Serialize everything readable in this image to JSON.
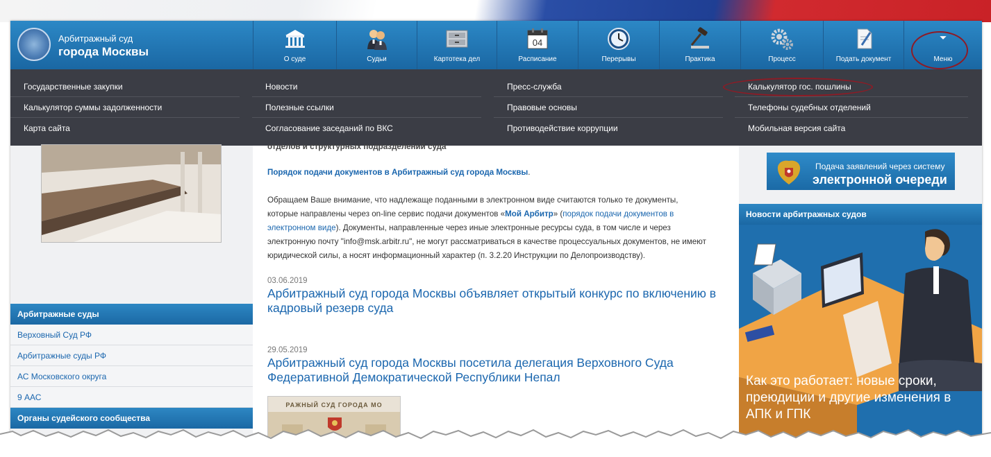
{
  "header": {
    "logo_line1": "Арбитражный суд",
    "logo_line2": "города Москвы"
  },
  "nav": [
    {
      "label": "О суде",
      "icon": "courthouse-icon"
    },
    {
      "label": "Судьи",
      "icon": "judges-icon"
    },
    {
      "label": "Картотека дел",
      "icon": "file-cabinet-icon"
    },
    {
      "label": "Расписание",
      "icon": "calendar-icon",
      "calendar_day": "04"
    },
    {
      "label": "Перерывы",
      "icon": "clock-icon"
    },
    {
      "label": "Практика",
      "icon": "gavel-icon"
    },
    {
      "label": "Процесс",
      "icon": "gears-icon"
    },
    {
      "label": "Подать документ",
      "icon": "document-pen-icon"
    },
    {
      "label": "Меню",
      "icon": "dropdown-arrow-icon"
    }
  ],
  "menu": {
    "col1": [
      "Государственные закупки",
      "Калькулятор суммы задолженности",
      "Карта сайта"
    ],
    "col2": [
      "Новости",
      "Полезные ссылки",
      "Согласование заседаний по ВКС"
    ],
    "col3": [
      "Пресс-служба",
      "Правовые основы",
      "Противодействие коррупции"
    ],
    "col4": [
      "Калькулятор гос. пошлины",
      "Телефоны судебных отделений",
      "Мобильная версия сайта"
    ]
  },
  "left": {
    "courts_header": "Арбитражные суды",
    "courts": [
      "Верховный Суд РФ",
      "Арбитражные суды РФ",
      "АС Московского округа",
      "9 ААС"
    ],
    "bodies_header": "Органы судейского сообщества"
  },
  "center": {
    "cut_text": "отделов и структурных подразделений суда",
    "procedure_link": "Порядок подачи документов в Арбитражный суд города Москвы",
    "notice_l1_a": "Обращаем Ваше внимание, что надлежаще поданными в электронном виде считаются только те документы,",
    "notice_l2_a": "которые направлены через on-line сервис подачи документов «",
    "notice_l2_link": "Мой Арбитр",
    "notice_l2_b": "» (",
    "notice_l2_link2": "порядок подачи документов в",
    "notice_l3_link": "электронном виде",
    "notice_l3_b": "). Документы, направленные через иные электронные ресурсы суда, в том числе и через",
    "notice_l4": "электронную почту \"info@msk.arbitr.ru\", не могут рассматриваться в качестве процессуальных документов, не имеют",
    "notice_l5": "юридической силы, а носят информационный характер (п. 3.2.20 Инструкции по Делопроизводству).",
    "news": [
      {
        "date": "03.06.2019",
        "title": "Арбитражный суд города Москвы объявляет открытый конкурс по включению в кадровый резерв суда"
      },
      {
        "date": "29.05.2019",
        "title": "Арбитражный суд города Москвы посетила делегация Верховного Суда Федеративной Демократической Республики Непал"
      }
    ],
    "photo_sign": "РАЖНЫЙ СУД ГОРОДА МО"
  },
  "right": {
    "queue_line1": "Подача заявлений через систему",
    "queue_line2": "электронной очереди",
    "news_header": "Новости арбитражных судов",
    "article_caption": "Как это работает: новые сроки, преюдиции и другие изменения в АПК и ГПК"
  }
}
